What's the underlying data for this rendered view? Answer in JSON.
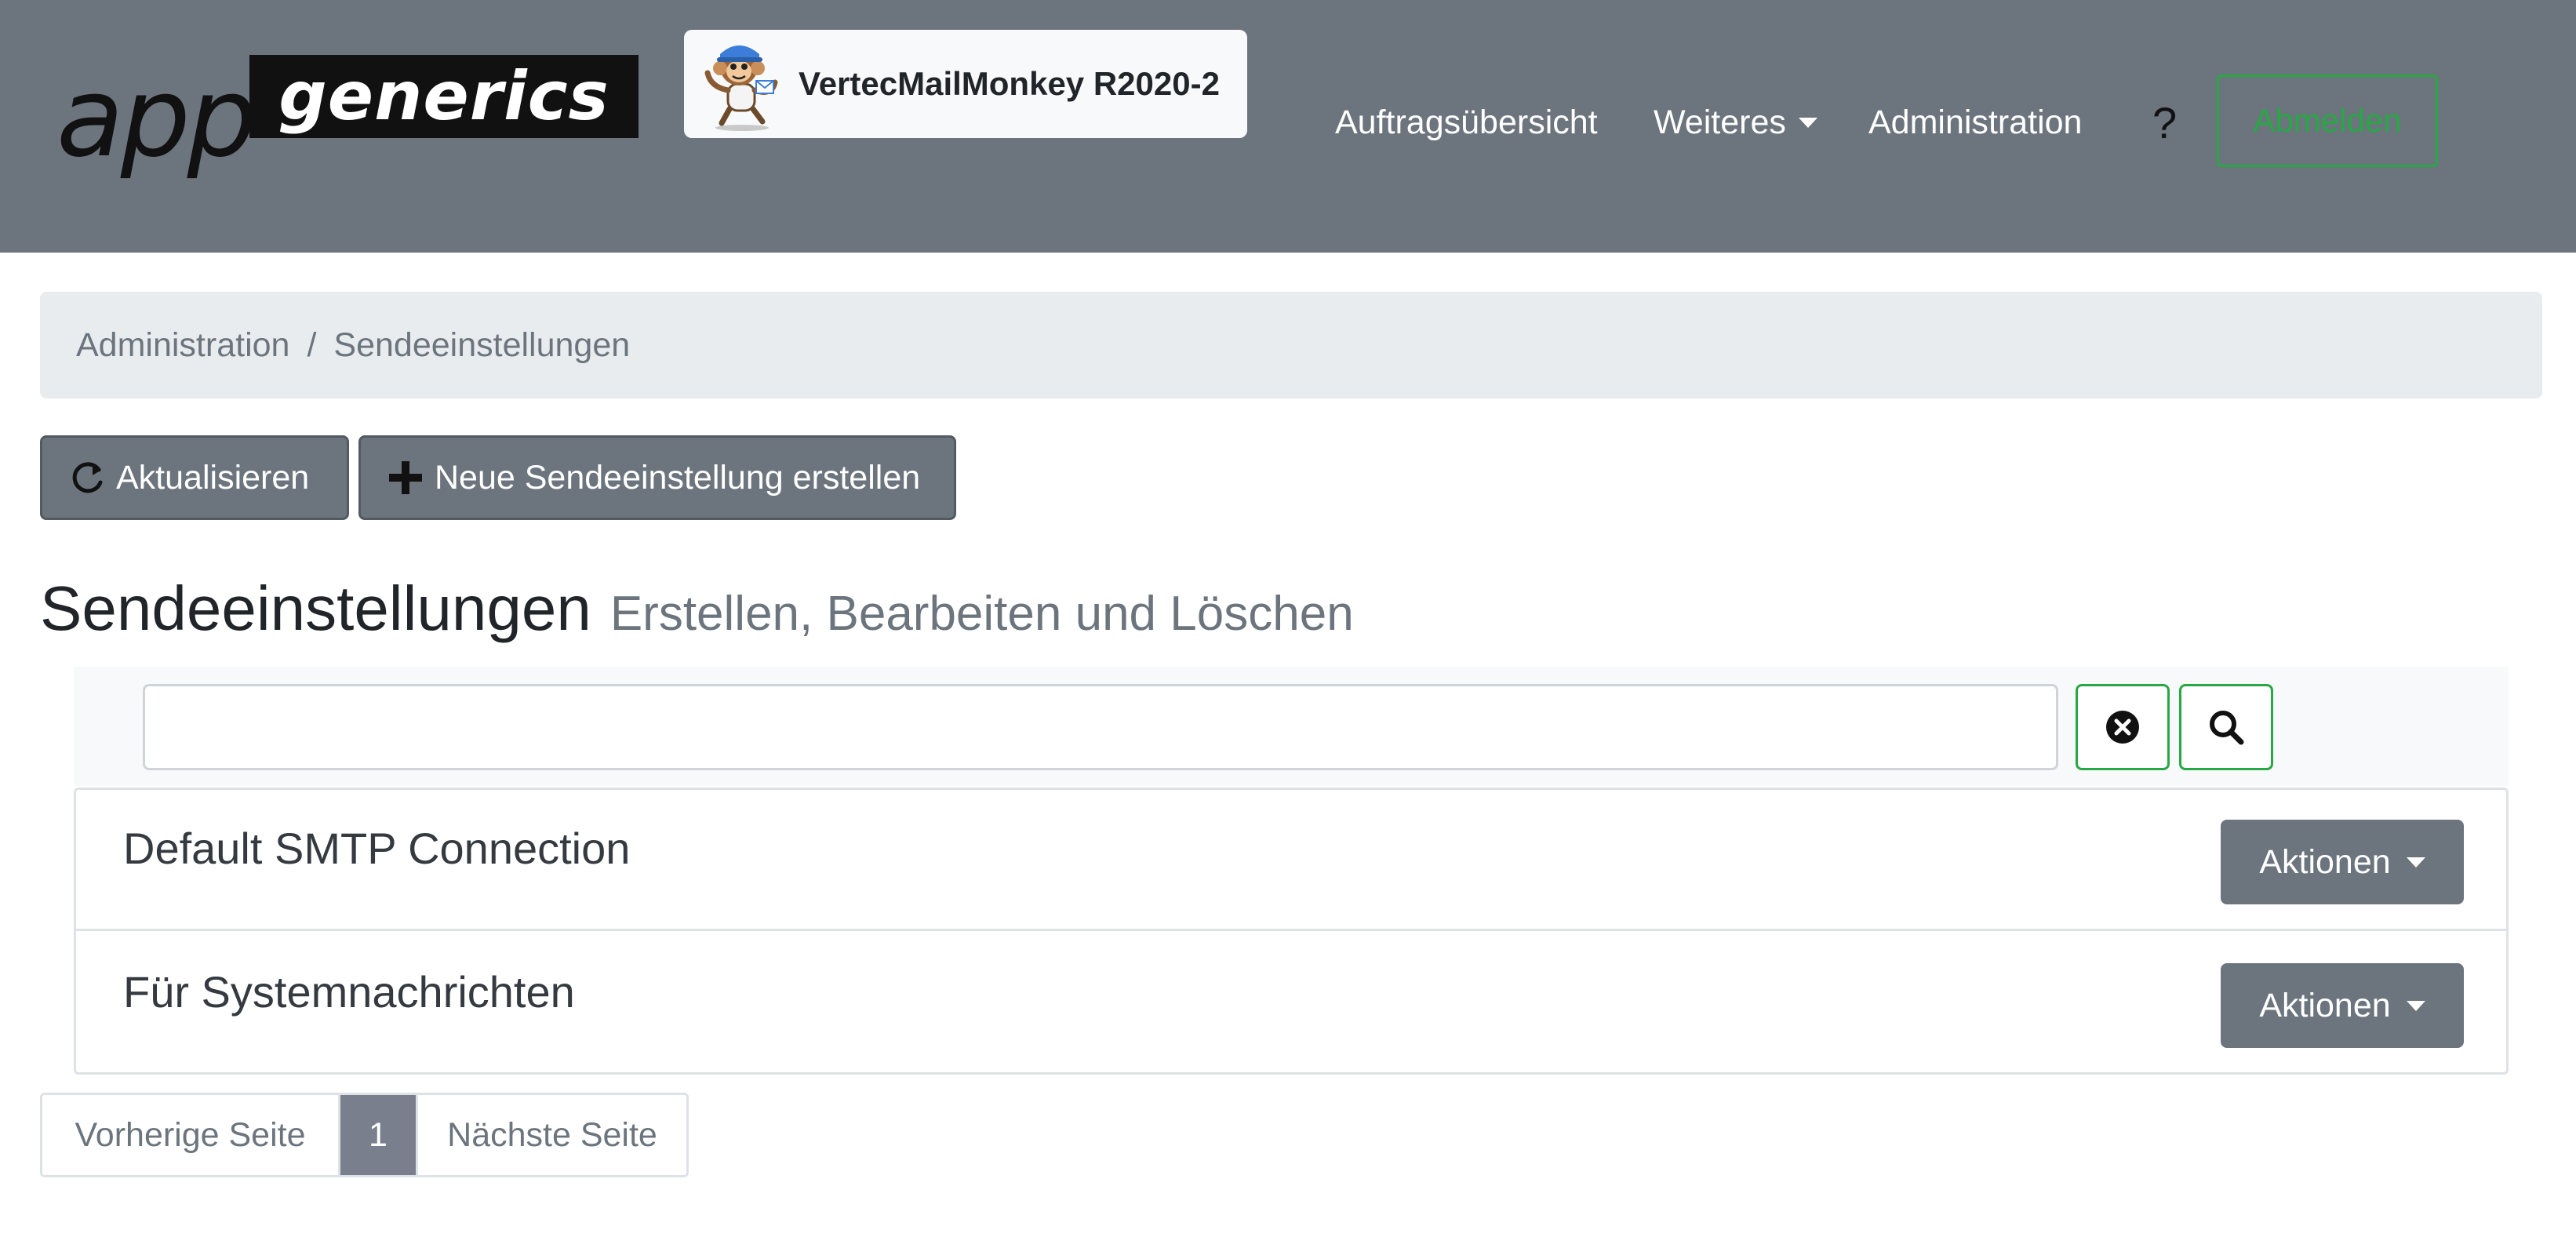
{
  "brand": {
    "app": "app",
    "generics": "generics"
  },
  "app_badge": {
    "title": "VertecMailMonkey R2020-2"
  },
  "nav": {
    "items": [
      {
        "label": "Auftragsübersicht"
      },
      {
        "label": "Weiteres"
      },
      {
        "label": "Administration"
      }
    ],
    "help": "?",
    "logout": "Abmelden"
  },
  "breadcrumb": {
    "parent": "Administration",
    "separator": "/",
    "current": "Sendeeinstellungen"
  },
  "toolbar": {
    "refresh": "Aktualisieren",
    "new": "Neue Sendeeinstellung erstellen"
  },
  "heading": {
    "title": "Sendeeinstellungen",
    "subtitle": "Erstellen, Bearbeiten und Löschen"
  },
  "search": {
    "value": "",
    "placeholder": ""
  },
  "list": {
    "items": [
      {
        "name": "Default SMTP Connection",
        "action": "Aktionen"
      },
      {
        "name": "Für Systemnachrichten",
        "action": "Aktionen"
      }
    ]
  },
  "pagination": {
    "prev": "Vorherige Seite",
    "page": "1",
    "next": "Nächste Seite"
  },
  "colors": {
    "navbar": "#6c747e",
    "accent_green": "#28a745",
    "button_dark": "#6c757d",
    "breadcrumb_bg": "#e9ecef"
  },
  "icons": {
    "refresh": "refresh-icon",
    "plus": "plus-icon",
    "clear": "clear-circle-icon",
    "search": "search-icon",
    "caret": "caret-down-icon",
    "mascot": "monkey-mascot-icon"
  }
}
